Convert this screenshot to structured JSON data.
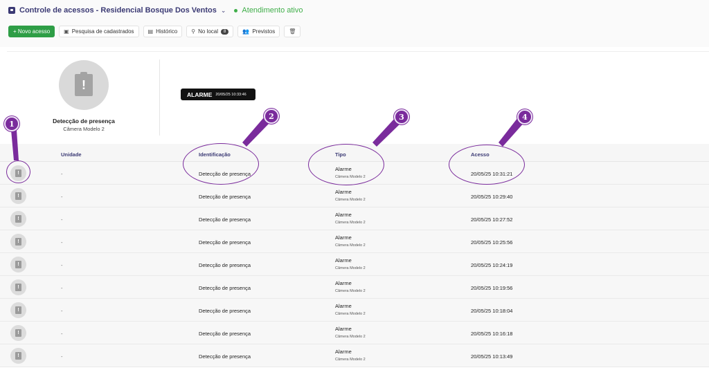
{
  "header": {
    "title": "Controle de acessos - Residencial Bosque Dos Ventos",
    "status": "Atendimento ativo",
    "colors": {
      "primary": "#3b3a74",
      "status": "#3fae49",
      "button": "#2e9e46",
      "annotation": "#7a2b9c"
    }
  },
  "toolbar": {
    "new_access": "+ Novo acesso",
    "search": "Pesquisa de cadastrados",
    "history": "Histórico",
    "on_site": "No local",
    "on_site_count": "8",
    "expected": "Previstos"
  },
  "detail": {
    "label": "Detecção de presença",
    "device": "Câmera Modelo 2",
    "alarm_label": "ALARME",
    "alarm_time": "20/05/25 10:33:46"
  },
  "table": {
    "headers": {
      "unit": "Unidade",
      "identification": "Identificação",
      "type": "Tipo",
      "access": "Acesso"
    },
    "rows": [
      {
        "unit": "-",
        "identification": "Detecção de presença",
        "type": "Alarme",
        "device": "Câmera Modelo 2",
        "access": "20/05/25 10:31:21"
      },
      {
        "unit": "-",
        "identification": "Detecção de presença",
        "type": "Alarme",
        "device": "Câmera Modelo 2",
        "access": "20/05/25 10:29:40"
      },
      {
        "unit": "-",
        "identification": "Detecção de presença",
        "type": "Alarme",
        "device": "Câmera Modelo 2",
        "access": "20/05/25 10:27:52"
      },
      {
        "unit": "-",
        "identification": "Detecção de presença",
        "type": "Alarme",
        "device": "Câmera Modelo 2",
        "access": "20/05/25 10:25:56"
      },
      {
        "unit": "-",
        "identification": "Detecção de presença",
        "type": "Alarme",
        "device": "Câmera Modelo 2",
        "access": "20/05/25 10:24:19"
      },
      {
        "unit": "-",
        "identification": "Detecção de presença",
        "type": "Alarme",
        "device": "Câmera Modelo 2",
        "access": "20/05/25 10:19:56"
      },
      {
        "unit": "-",
        "identification": "Detecção de presença",
        "type": "Alarme",
        "device": "Câmera Modelo 2",
        "access": "20/05/25 10:18:04"
      },
      {
        "unit": "-",
        "identification": "Detecção de presença",
        "type": "Alarme",
        "device": "Câmera Modelo 2",
        "access": "20/05/25 10:16:18"
      },
      {
        "unit": "-",
        "identification": "Detecção de presença",
        "type": "Alarme",
        "device": "Câmera Modelo 2",
        "access": "20/05/25 10:13:49"
      }
    ]
  },
  "annotations": [
    "1",
    "2",
    "3",
    "4"
  ]
}
